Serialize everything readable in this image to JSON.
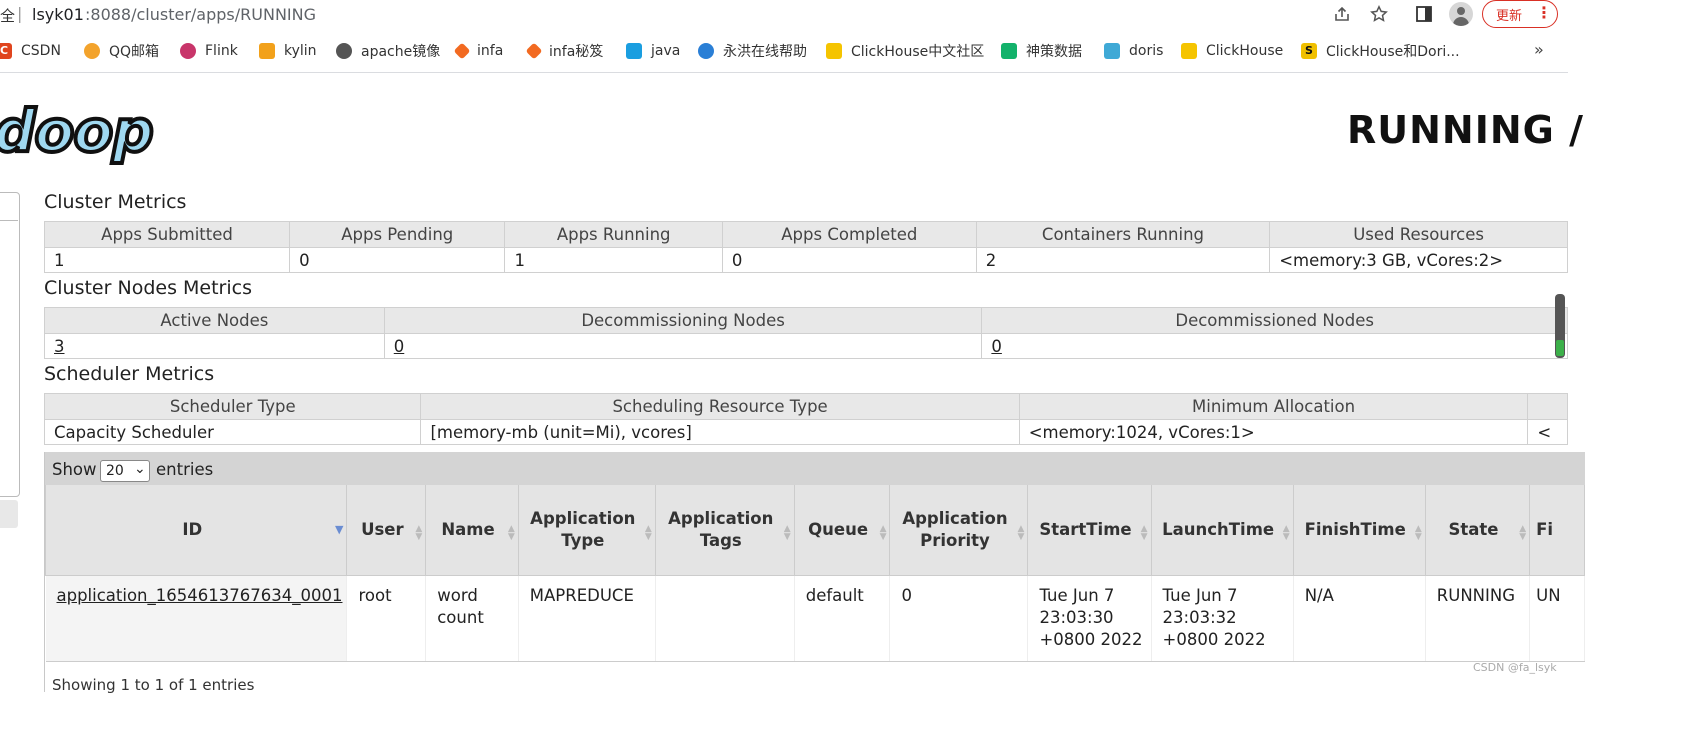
{
  "browser": {
    "addr_prefix": "全",
    "addr_sep": "|",
    "url_host": "lsyk01",
    "url_rest": ":8088/cluster/apps/RUNNING",
    "update_label": "更新",
    "update_menu": "⋮",
    "bookmarks": [
      {
        "label": "CSDN",
        "icon_color": "#e0451e",
        "icon": "csdn-icon"
      },
      {
        "label": "QQ邮箱",
        "icon_color": "#f3a32c",
        "icon": "qq-mail-icon"
      },
      {
        "label": "Flink",
        "icon_color": "#c8356a",
        "icon": "flink-icon"
      },
      {
        "label": "kylin",
        "icon_color": "#f2a11b",
        "icon": "kylin-icon"
      },
      {
        "label": "apache镜像",
        "icon_color": "#555555",
        "icon": "globe-icon"
      },
      {
        "label": "infa",
        "icon_color": "#f26a21",
        "icon": "infa-icon"
      },
      {
        "label": "infa秘笈",
        "icon_color": "#f26a21",
        "icon": "infa-icon"
      },
      {
        "label": "java",
        "icon_color": "#1a9ee0",
        "icon": "bilibili-icon"
      },
      {
        "label": "永洪在线帮助",
        "icon_color": "#2a7fd6",
        "icon": "yonghong-icon"
      },
      {
        "label": "ClickHouse中文社区",
        "icon_color": "#f5c400",
        "icon": "clickhouse-icon"
      },
      {
        "label": "神策数据",
        "icon_color": "#13b26b",
        "icon": "sensors-icon"
      },
      {
        "label": "doris",
        "icon_color": "#3fa9d6",
        "icon": "doris-icon"
      },
      {
        "label": "ClickHouse",
        "icon_color": "#f5c400",
        "icon": "clickhouse-icon"
      },
      {
        "label": "ClickHouse和Dori...",
        "icon_color": "#f0c000",
        "icon": "sogou-icon"
      }
    ],
    "bookmarks_more": "»"
  },
  "page": {
    "logo_text": "doop",
    "title": "RUNNING /"
  },
  "cluster_metrics": {
    "title": "Cluster Metrics",
    "headers": [
      "Apps Submitted",
      "Apps Pending",
      "Apps Running",
      "Apps Completed",
      "Containers Running",
      "Used Resources"
    ],
    "values": [
      "1",
      "0",
      "1",
      "0",
      "2",
      "<memory:3 GB, vCores:2>"
    ]
  },
  "nodes_metrics": {
    "title": "Cluster Nodes Metrics",
    "headers": [
      "Active Nodes",
      "Decommissioning Nodes",
      "Decommissioned Nodes"
    ],
    "values": [
      "3",
      "0",
      "0"
    ]
  },
  "scheduler_metrics": {
    "title": "Scheduler Metrics",
    "headers": [
      "Scheduler Type",
      "Scheduling Resource Type",
      "Minimum Allocation",
      ""
    ],
    "values": [
      "Capacity Scheduler",
      "[memory-mb (unit=Mi), vcores]",
      "<memory:1024, vCores:1>",
      "<"
    ]
  },
  "apps": {
    "show_label": "Show",
    "page_size": "20",
    "entries_label": "entries",
    "headers": [
      "ID",
      "User",
      "Name",
      "Application Type",
      "Application Tags",
      "Queue",
      "Application Priority",
      "StartTime",
      "LaunchTime",
      "FinishTime",
      "State",
      "Fi"
    ],
    "rows": [
      [
        "application_1654613767634_0001",
        "root",
        "word count",
        "MAPREDUCE",
        "",
        "default",
        "0",
        "Tue Jun 7 23:03:30 +0800 2022",
        "Tue Jun 7 23:03:32 +0800 2022",
        "N/A",
        "RUNNING",
        "UN"
      ]
    ],
    "footer": "Showing 1 to 1 of 1 entries"
  },
  "watermark": "CSDN @fa_lsyk"
}
